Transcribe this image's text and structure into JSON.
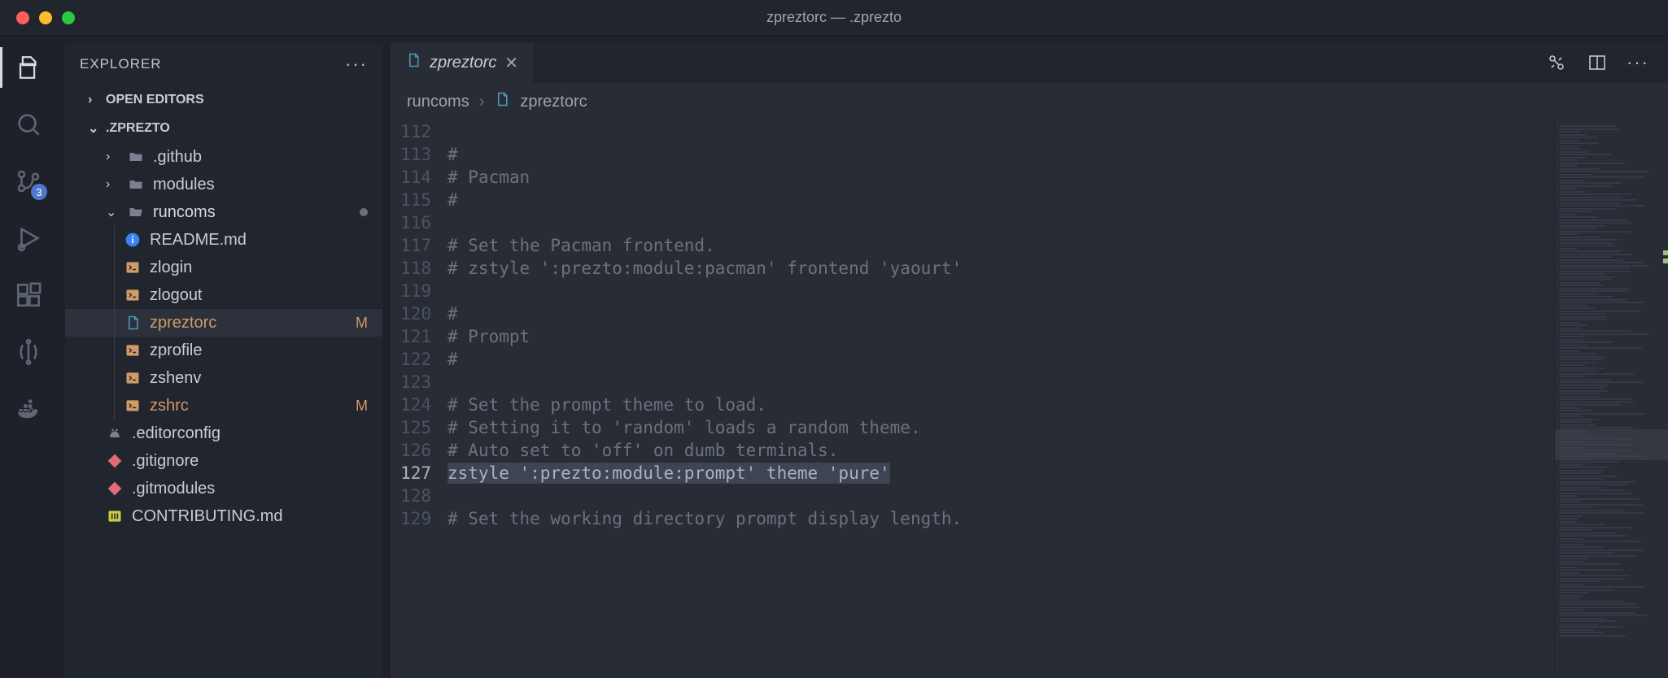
{
  "window": {
    "title": "zpreztorc — .zprezto"
  },
  "sidebar": {
    "title": "EXPLORER",
    "openEditorsLabel": "OPEN EDITORS",
    "rootLabel": ".ZPREZTO"
  },
  "tree": {
    "items": [
      {
        "label": ".github",
        "type": "folder",
        "expanded": false
      },
      {
        "label": "modules",
        "type": "folder",
        "expanded": false
      },
      {
        "label": "runcoms",
        "type": "folder",
        "expanded": true,
        "dirty": true
      },
      {
        "label": "README.md",
        "type": "file",
        "icon": "info"
      },
      {
        "label": "zlogin",
        "type": "file",
        "icon": "shell"
      },
      {
        "label": "zlogout",
        "type": "file",
        "icon": "shell"
      },
      {
        "label": "zpreztorc",
        "type": "file",
        "icon": "file",
        "status": "M",
        "selected": true,
        "modified": true
      },
      {
        "label": "zprofile",
        "type": "file",
        "icon": "shell"
      },
      {
        "label": "zshenv",
        "type": "file",
        "icon": "shell"
      },
      {
        "label": "zshrc",
        "type": "file",
        "icon": "shell",
        "status": "M",
        "modified": true
      },
      {
        "label": ".editorconfig",
        "type": "file",
        "icon": "editorconfig"
      },
      {
        "label": ".gitignore",
        "type": "file",
        "icon": "git"
      },
      {
        "label": ".gitmodules",
        "type": "file",
        "icon": "git"
      },
      {
        "label": "CONTRIBUTING.md",
        "type": "file",
        "icon": "md"
      }
    ]
  },
  "tab": {
    "label": "zpreztorc"
  },
  "breadcrumb": {
    "part1": "runcoms",
    "part2": "zpreztorc"
  },
  "scm": {
    "badge": "3"
  },
  "editor": {
    "activeLine": 127,
    "lines": [
      {
        "n": 112,
        "text": ""
      },
      {
        "n": 113,
        "text": "#"
      },
      {
        "n": 114,
        "text": "# Pacman"
      },
      {
        "n": 115,
        "text": "#"
      },
      {
        "n": 116,
        "text": ""
      },
      {
        "n": 117,
        "text": "# Set the Pacman frontend."
      },
      {
        "n": 118,
        "text": "# zstyle ':prezto:module:pacman' frontend 'yaourt'"
      },
      {
        "n": 119,
        "text": ""
      },
      {
        "n": 120,
        "text": "#"
      },
      {
        "n": 121,
        "text": "# Prompt"
      },
      {
        "n": 122,
        "text": "#"
      },
      {
        "n": 123,
        "text": ""
      },
      {
        "n": 124,
        "text": "# Set the prompt theme to load."
      },
      {
        "n": 125,
        "text": "# Setting it to 'random' loads a random theme."
      },
      {
        "n": 126,
        "text": "# Auto set to 'off' on dumb terminals."
      },
      {
        "n": 127,
        "text": "zstyle ':prezto:module:prompt' theme 'pure'",
        "selected": true
      },
      {
        "n": 128,
        "text": ""
      },
      {
        "n": 129,
        "text": "# Set the working directory prompt display length."
      }
    ]
  }
}
